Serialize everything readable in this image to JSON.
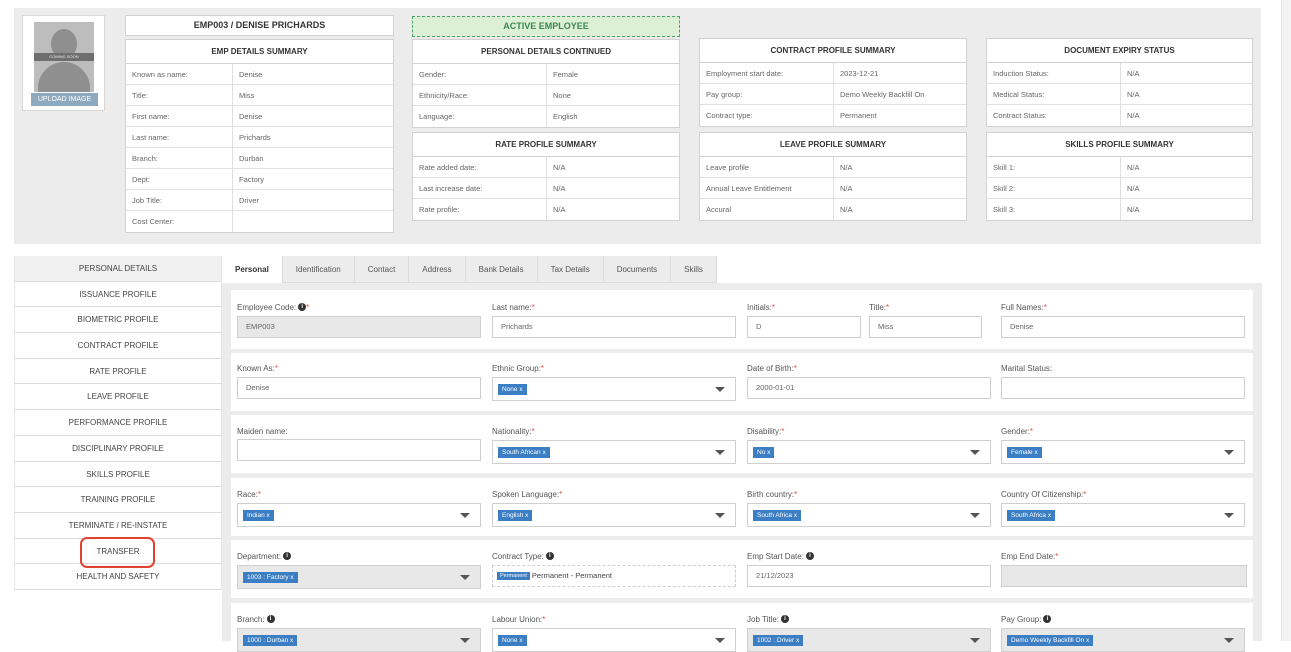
{
  "employee_header": "EMP003 / DENISE PRICHARDS",
  "status_banner": "ACTIVE EMPLOYEE",
  "photo": {
    "placeholder_text": "COMING SOON",
    "upload_label": "UPLOAD IMAGE"
  },
  "emp_summary": {
    "title": "EMP DETAILS SUMMARY",
    "rows": [
      {
        "k": "Known as name:",
        "v": "Denise"
      },
      {
        "k": "Title:",
        "v": "Miss"
      },
      {
        "k": "First name:",
        "v": "Denise"
      },
      {
        "k": "Last name:",
        "v": "Prichards"
      },
      {
        "k": "Branch:",
        "v": "Durban"
      },
      {
        "k": "Dept:",
        "v": "Factory"
      },
      {
        "k": "Job Title:",
        "v": "Driver"
      },
      {
        "k": "Cost Center:",
        "v": ""
      }
    ]
  },
  "personal_continued": {
    "title": "PERSONAL DETAILS CONTINUED",
    "rows": [
      {
        "k": "Gender:",
        "v": "Female"
      },
      {
        "k": "Ethnicity/Race:",
        "v": "None"
      },
      {
        "k": "Language:",
        "v": "English"
      }
    ]
  },
  "rate_summary": {
    "title": "RATE PROFILE SUMMARY",
    "rows": [
      {
        "k": "Rate added date:",
        "v": "N/A"
      },
      {
        "k": "Last increase date:",
        "v": "N/A"
      },
      {
        "k": "Rate profile:",
        "v": "N/A"
      }
    ]
  },
  "contract_summary": {
    "title": "CONTRACT PROFILE SUMMARY",
    "rows": [
      {
        "k": "Employment start date:",
        "v": "2023-12-21"
      },
      {
        "k": "Pay group:",
        "v": "Demo Weekly Backfill On"
      },
      {
        "k": "Contract type:",
        "v": "Permanent"
      }
    ]
  },
  "leave_summary": {
    "title": "LEAVE PROFILE SUMMARY",
    "rows": [
      {
        "k": "Leave profile",
        "v": "N/A"
      },
      {
        "k": "Annual Leave Entitlement",
        "v": "N/A"
      },
      {
        "k": "Accural",
        "v": "N/A"
      }
    ]
  },
  "document_expiry": {
    "title": "DOCUMENT EXPIRY STATUS",
    "rows": [
      {
        "k": "Induction Status:",
        "v": "N/A"
      },
      {
        "k": "Medical Status:",
        "v": "N/A"
      },
      {
        "k": "Contract Status:",
        "v": "N/A"
      }
    ]
  },
  "skills_summary": {
    "title": "SKILLS PROFILE SUMMARY",
    "rows": [
      {
        "k": "Skill 1:",
        "v": "N/A"
      },
      {
        "k": "Skill 2:",
        "v": "N/A"
      },
      {
        "k": "Skill 3:",
        "v": "N/A"
      }
    ]
  },
  "sidebar": {
    "items": [
      "PERSONAL DETAILS",
      "ISSUANCE PROFILE",
      "BIOMETRIC PROFILE",
      "CONTRACT PROFILE",
      "RATE PROFILE",
      "LEAVE PROFILE",
      "PERFORMANCE PROFILE",
      "DISCIPLINARY PROFILE",
      "SKILLS PROFILE",
      "TRAINING PROFILE",
      "TERMINATE / RE-INSTATE",
      "TRANSFER",
      "HEALTH AND SAFETY"
    ]
  },
  "tabs": [
    "Personal",
    "Identification",
    "Contact",
    "Address",
    "Bank Details",
    "Tax Details",
    "Documents",
    "Skills"
  ],
  "form": {
    "employee_code": {
      "label": "Employee Code:",
      "value": "EMP003"
    },
    "last_name": {
      "label": "Last name:",
      "value": "Prichards"
    },
    "initials": {
      "label": "Initials:",
      "value": "D"
    },
    "title": {
      "label": "Title:",
      "value": "Miss"
    },
    "full_names": {
      "label": "Full Names:",
      "value": "Denise"
    },
    "known_as": {
      "label": "Known As:",
      "value": "Denise"
    },
    "ethnic_group": {
      "label": "Ethnic Group:",
      "value": "None x"
    },
    "dob": {
      "label": "Date of Birth:",
      "value": "2000-01-01"
    },
    "marital": {
      "label": "Marital Status:",
      "value": ""
    },
    "maiden": {
      "label": "Maiden name:",
      "value": ""
    },
    "nationality": {
      "label": "Nationality:",
      "value": "South African x"
    },
    "disability": {
      "label": "Disability:",
      "value": "No x"
    },
    "gender": {
      "label": "Gender:",
      "value": "Female x"
    },
    "race": {
      "label": "Race:",
      "value": "Indian x"
    },
    "spoken_language": {
      "label": "Spoken Language:",
      "value": "English x"
    },
    "birth_country": {
      "label": "Birth country:",
      "value": "South Africa x"
    },
    "citizenship": {
      "label": "Country Of Citizenship:",
      "value": "South Africa x"
    },
    "department": {
      "label": "Department:",
      "value": "1003 : Factory x"
    },
    "contract_type": {
      "label": "Contract Type:",
      "chip": "Permanent",
      "value": "Permanent - Permanent"
    },
    "emp_start": {
      "label": "Emp Start Date:",
      "value": "21/12/2023"
    },
    "emp_end": {
      "label": "Emp End Date:",
      "value": ""
    },
    "branch": {
      "label": "Branch:",
      "value": "1000 : Durban x"
    },
    "labour_union": {
      "label": "Labour Union:",
      "value": "None x"
    },
    "job_title": {
      "label": "Job Title:",
      "value": "1002 : Driver x"
    },
    "pay_group": {
      "label": "Pay Group:",
      "value": "Demo Weekly Backfill On x"
    }
  },
  "required_mark": "*",
  "info_mark": "i",
  "colors": {
    "accent": "#3c7ec3",
    "active_green": "#3a8751",
    "highlight": "#e04431"
  }
}
